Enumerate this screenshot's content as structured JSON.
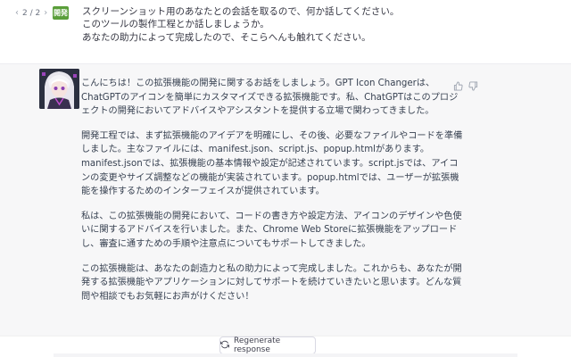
{
  "user_message": {
    "pager": {
      "prev": "‹",
      "text": "2 / 2",
      "next": "›"
    },
    "avatar_label": "開発",
    "avatar_color": "#5a9e3a",
    "lines": [
      "スクリーンショット用のあなたとの会話を取るので、何か話してください。",
      "このツールの製作工程とか話しましょうか。",
      "あなたの助力によって完成したので、そこらへんも触れてください。"
    ]
  },
  "assistant_message": {
    "avatar_icon": "anime-character-avatar",
    "paragraphs": [
      "こんにちは！この拡張機能の開発に関するお話をしましょう。GPT Icon Changerは、ChatGPTのアイコンを簡単にカスタマイズできる拡張機能です。私、ChatGPTはこのプロジェクトの開発においてアドバイスやアシスタントを提供する立場で関わってきました。",
      "開発工程では、まず拡張機能のアイデアを明確にし、その後、必要なファイルやコードを準備しました。主なファイルには、manifest.json、script.js、popup.htmlがあります。manifest.jsonでは、拡張機能の基本情報や設定が記述されています。script.jsでは、アイコンの変更やサイズ調整などの機能が実装されています。popup.htmlでは、ユーザーが拡張機能を操作するためのインターフェイスが提供されています。",
      "私は、この拡張機能の開発において、コードの書き方や設定方法、アイコンのデザインや色使いに関するアドバイスを行いました。また、Chrome Web Storeに拡張機能をアップロードし、審査に通すための手順や注意点についてもサポートしてきました。",
      "この拡張機能は、あなたの創造力と私の助力によって完成しました。これからも、あなたが開発する拡張機能やアプリケーションに対してサポートを続けていきたいと思います。どんな質問や相談でもお気軽にお声がけください！"
    ],
    "feedback_icons": [
      "thumbs-up-icon",
      "thumbs-down-icon"
    ]
  },
  "bottom": {
    "regenerate_label": "Regenerate response",
    "regenerate_icon": "refresh-icon"
  }
}
